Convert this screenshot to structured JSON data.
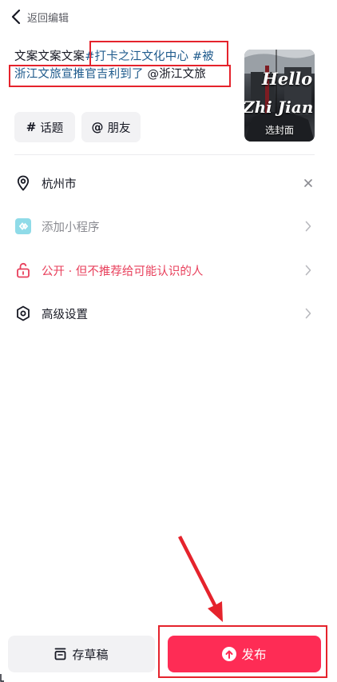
{
  "header": {
    "back_label": "返回编辑",
    "back_icon": "chevron-left-icon"
  },
  "caption": {
    "plain": "文案文案文案",
    "tag1_part1": "#打卡之江文化中心 #被",
    "tag2_part2": "浙江文旅宣推官吉利到了",
    "mention": " @浙江文旅"
  },
  "cover": {
    "title1": "Hello",
    "title2": "Zhi Jian",
    "label": "选封面"
  },
  "chips": {
    "topic_symbol": "#",
    "topic": "话题",
    "friend_symbol": "@",
    "friend": "朋友"
  },
  "settings": {
    "location": {
      "label": "杭州市",
      "icon": "location-pin-icon",
      "trailing": "close-icon"
    },
    "miniapp": {
      "label": "添加小程序",
      "icon": "mini-program-icon",
      "trailing": "chevron-right-icon"
    },
    "privacy": {
      "label": "公开 · 但不推荐给可能认识的人",
      "icon": "unlock-icon",
      "trailing": "chevron-right-icon"
    },
    "advanced": {
      "label": "高级设置",
      "icon": "hexagon-settings-icon",
      "trailing": "chevron-right-icon"
    }
  },
  "footer": {
    "draft_label": "存草稿",
    "publish_label": "发布"
  },
  "colors": {
    "accent": "#fe2c55",
    "hashtag": "#1e5a8c",
    "annotation": "#e5232c",
    "miniapp_icon": "#4fc3d9",
    "privacy_text": "#e8405c",
    "muted_text": "#8a8b91"
  }
}
